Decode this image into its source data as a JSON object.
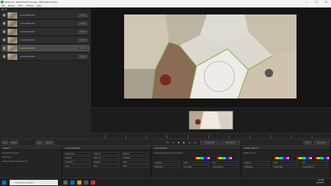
{
  "window": {
    "title": "Mistika VR - [PENSIG02 [Universe]] - 3840x1920 29.97fps",
    "minimize": "—",
    "maximize": "☐",
    "close": "✕"
  },
  "menu": [
    "File",
    "Events",
    "Track",
    "Window",
    "Help"
  ],
  "media_list": [
    {
      "name": "H2O1118E.MP4",
      "duration": "00:00",
      "selected": false
    },
    {
      "name": "H2O2080E.MP4",
      "duration": "00:00",
      "selected": false
    },
    {
      "name": "H3O2080E.MP4",
      "duration": "00:00",
      "selected": false
    },
    {
      "name": "H4O2080E.MP4",
      "duration": "00:00",
      "selected": false
    },
    {
      "name": "H5O2080E.MP4",
      "duration": "00:00",
      "selected": true
    },
    {
      "name": "H6O2080E.MP4",
      "duration": "00:00",
      "selected": false
    }
  ],
  "viewer_bar": {
    "scale": "Scale",
    "scale_val": "Default",
    "color": "Color",
    "color_val": "Rec709",
    "zoom": "100%",
    "quick": "Quick Mix"
  },
  "transport": {
    "timecode_in": "00:00:00:00",
    "timecode_out": "00:00:00:00"
  },
  "panels": {
    "options": {
      "title": "Options",
      "rows": [
        "Hide Stitched Preview",
        "Stitch Track",
        "Overview Option  Optical Flow Off"
      ]
    },
    "camera_defaults": {
      "title": "Camera Defaults",
      "fields": [
        "Focus point",
        "Offset X",
        "Offset Y",
        "Offset Z",
        "Hor. Fov",
        "Vert Fov",
        "Lens Dist",
        "Feather",
        "Pitch",
        "Yaw",
        "Roll",
        "Shift"
      ]
    },
    "input_camera": {
      "title": "Input Camera",
      "sub": "Masking  Algorithmic Mask ▾   Enabled ▾",
      "fields": [
        "Gamma",
        "Gain",
        "Lift",
        "Saturation",
        "Input gain",
        "Input gamma"
      ]
    },
    "output_camera": {
      "title": "Output Camera",
      "sub": "Masking  Gallery",
      "fields": [
        "Gamma",
        "Gain",
        "Lift",
        "Saturation",
        "Output gain",
        "Output gamma"
      ]
    }
  },
  "taskbar": {
    "search": "Type here to search",
    "time": "1:44 PM",
    "date": "8/14/2017"
  },
  "colors": {
    "accent": "#8fd14f",
    "panel": "#232323",
    "bg": "#1a1a1a"
  }
}
